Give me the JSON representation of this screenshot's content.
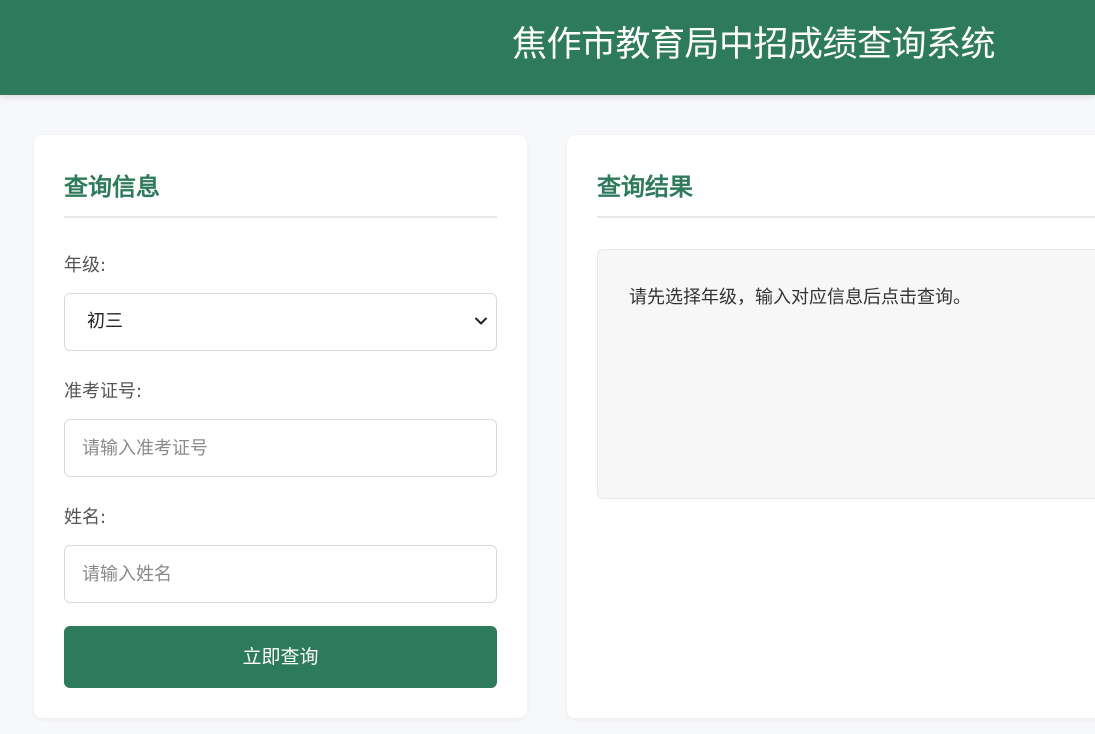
{
  "header": {
    "title": "焦作市教育局中招成绩查询系统",
    "background_color": "#2d7a5c"
  },
  "query_form": {
    "title": "查询信息",
    "grade": {
      "label": "年级:",
      "selected": "初三",
      "icon": "chevron-down-icon"
    },
    "exam_number": {
      "label": "准考证号:",
      "value": "",
      "placeholder": "请输入准考证号"
    },
    "name": {
      "label": "姓名:",
      "value": "",
      "placeholder": "请输入姓名"
    },
    "submit_label": "立即查询"
  },
  "result_panel": {
    "title": "查询结果",
    "message": "请先选择年级，输入对应信息后点击查询。"
  },
  "colors": {
    "accent": "#2d7a5c",
    "page_background": "#f7f8fa"
  }
}
